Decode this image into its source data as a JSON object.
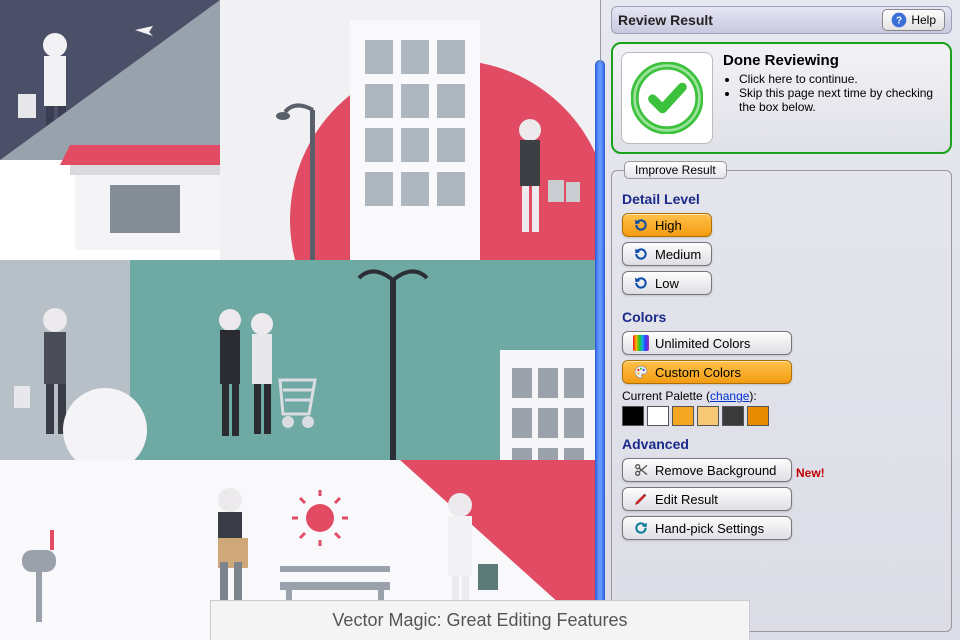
{
  "header": {
    "title": "Review Result",
    "help_label": "Help"
  },
  "done": {
    "title": "Done Reviewing",
    "bullet1": "Click here to continue.",
    "bullet2": "Skip this page next time by checking the box below."
  },
  "improve": {
    "legend": "Improve Result",
    "detail": {
      "heading": "Detail Level",
      "high": "High",
      "medium": "Medium",
      "low": "Low",
      "selected": "High"
    },
    "colors": {
      "heading": "Colors",
      "unlimited": "Unlimited Colors",
      "custom": "Custom Colors",
      "selected": "Custom Colors",
      "palette_label": "Current Palette (",
      "change": "change",
      "palette_label_end": "):",
      "swatches": [
        "#000000",
        "#ffffff",
        "#f5a623",
        "#f7c873",
        "#3a3a3a",
        "#e88b00"
      ]
    },
    "advanced": {
      "heading": "Advanced",
      "remove_bg": "Remove Background",
      "new_tag": "New!",
      "edit_result": "Edit Result",
      "hand_pick": "Hand-pick Settings"
    }
  },
  "caption": "Vector Magic: Great Editing Features"
}
